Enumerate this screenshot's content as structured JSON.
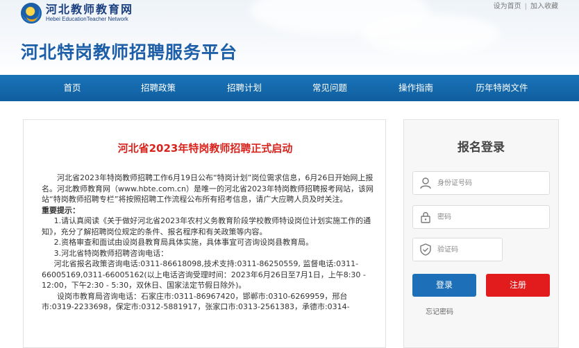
{
  "site": {
    "logo_cn": "河北教师教育网",
    "logo_en": "Hebei EducationTeacher Network",
    "title": "河北特岗教师招聘服务平台"
  },
  "top_links": {
    "set_home": "设为首页",
    "separator": "|",
    "add_fav": "加入收藏"
  },
  "nav": {
    "items": [
      {
        "label": "首页"
      },
      {
        "label": "招聘政策"
      },
      {
        "label": "招聘计划"
      },
      {
        "label": "常见问题"
      },
      {
        "label": "操作指南"
      },
      {
        "label": "历年特岗文件"
      }
    ]
  },
  "article": {
    "title": "河北省2023年特岗教师招聘正式启动",
    "intro": "河北省2023年特岗教师招聘工作6月19日公布“特岗计划”岗位需求信息，6月26日开始网上报名。河北教师教育网（www.hbte.com.cn）是唯一的河北省2023年特岗教师招聘报考网站，该网站“特岗教师招聘专栏”将按照招聘工作流程公布所有招考信息，请广大应聘人员及时关注。",
    "notice_heading": "重要提示：",
    "notice_1": "1.请认真阅读《关于做好河北省2023年农村义务教育阶段学校教师特设岗位计划实施工作的通知》，充分了解招聘岗位规定的条件、报名程序和有关政策等内容。",
    "notice_2": "2.资格审查和面试由设岗县教育局具体实施，具体事宜可咨询设岗县教育局。",
    "notice_3": "3.河北省特岗教师招聘咨询电话：",
    "notice_3_detail": "河北省报名政策咨询电话:0311-86618098,技术支持:0311-86250559, 监督电话:0311-66005169,0311-66005162(以上电话咨询受理时间：2023年6月26日至7月1日，上午8:30 - 12:00，下午2:30 - 5:30，双休日、国家法定节假日除外)。",
    "notice_3_cities": "设岗市教育局咨询电话：石家庄市:0311-86967420，邯郸市:0310-6269959，邢台市:0319-2233698，保定市:0312-5881917，张家口市:0313-2561383，承德市:0314-"
  },
  "login": {
    "title": "报名登录",
    "id_placeholder": "身份证号码",
    "password_placeholder": "密码",
    "captcha_placeholder": "验证码",
    "login_button": "登录",
    "register_button": "注册",
    "forgot": "忘记密码",
    "colors": {
      "login": "#1d6fb8",
      "register": "#e21c1c"
    }
  },
  "colors": {
    "nav_bg": "#1a73b8",
    "title_blue": "#1d5ea8",
    "headline_red": "#d8231d"
  }
}
